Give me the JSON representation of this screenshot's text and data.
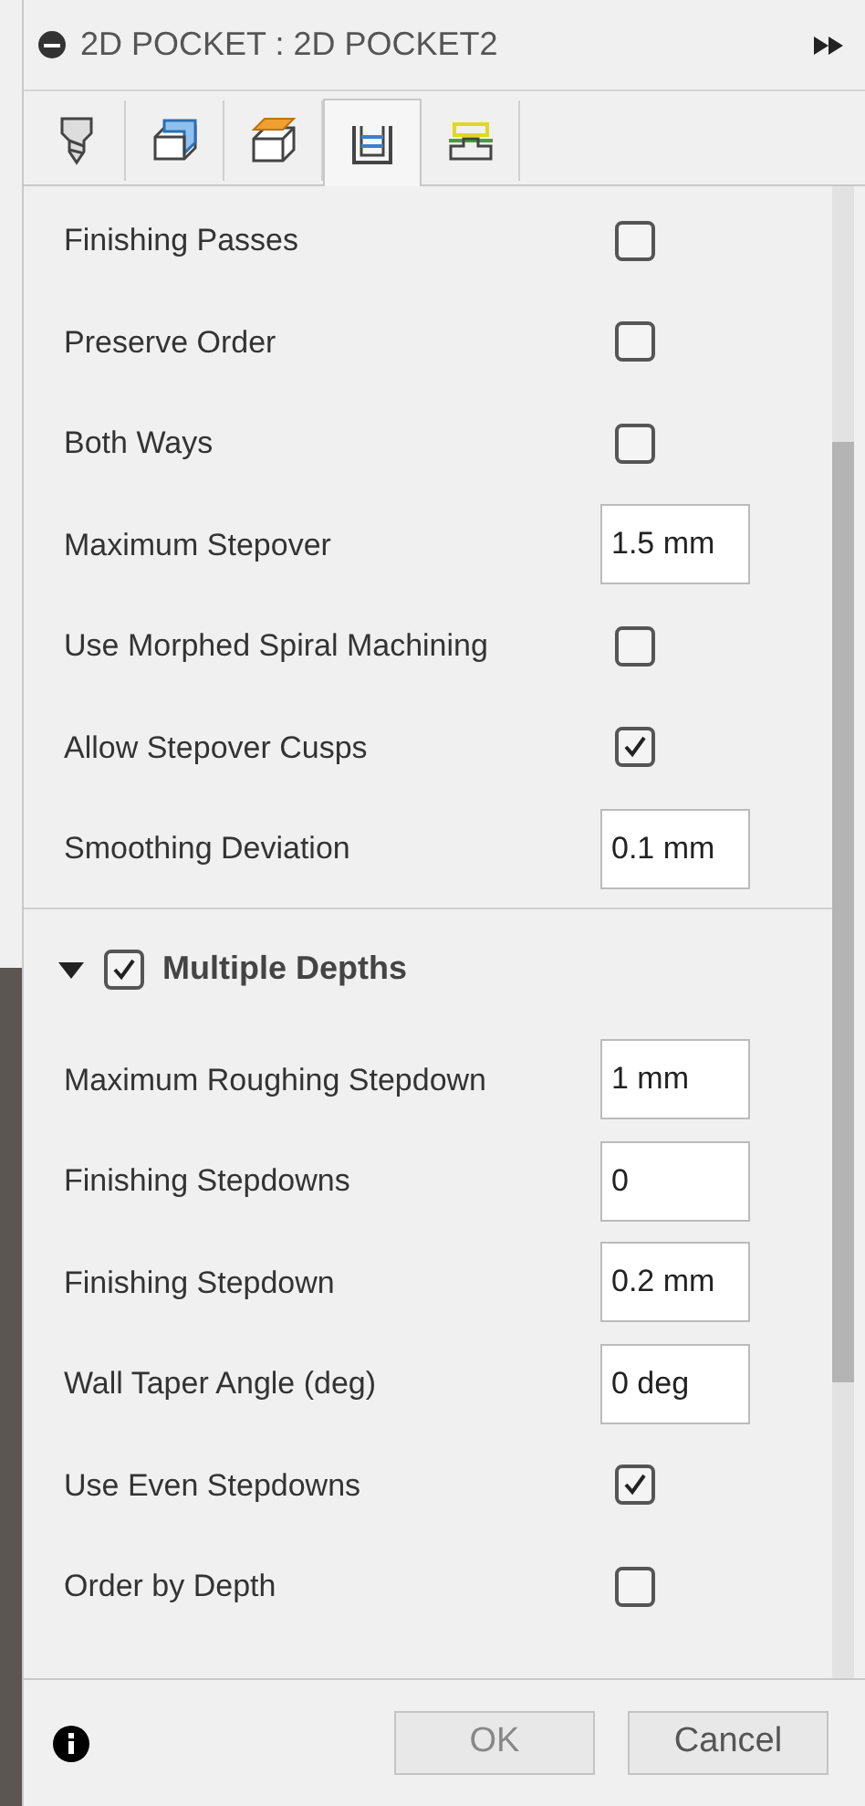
{
  "title": "2D POCKET : 2D POCKET2",
  "tabs": [
    {
      "kind": "tool",
      "selected": false
    },
    {
      "kind": "geometry",
      "selected": false
    },
    {
      "kind": "heights",
      "selected": false
    },
    {
      "kind": "passes",
      "selected": true
    },
    {
      "kind": "linking",
      "selected": false
    }
  ],
  "rows": [
    {
      "kind": "checkbox",
      "label": "Finishing Passes",
      "checked": false
    },
    {
      "kind": "checkbox",
      "label": "Preserve Order",
      "checked": false
    },
    {
      "kind": "checkbox",
      "label": "Both Ways",
      "checked": false
    },
    {
      "kind": "input",
      "label": "Maximum Stepover",
      "value": "1.5 mm"
    },
    {
      "kind": "checkbox",
      "label": "Use Morphed Spiral Machining",
      "checked": false
    },
    {
      "kind": "checkbox",
      "label": "Allow Stepover Cusps",
      "checked": true
    },
    {
      "kind": "input",
      "label": "Smoothing Deviation",
      "value": "0.1 mm"
    }
  ],
  "section": {
    "label": "Multiple Depths",
    "expanded": true,
    "checked": true,
    "rows": [
      {
        "kind": "input",
        "label": "Maximum Roughing Stepdown",
        "value": "1 mm"
      },
      {
        "kind": "input",
        "label": "Finishing Stepdowns",
        "value": "0"
      },
      {
        "kind": "input",
        "label": "Finishing Stepdown",
        "value": "0.2 mm"
      },
      {
        "kind": "input",
        "label": "Wall Taper Angle (deg)",
        "value": "0 deg"
      },
      {
        "kind": "checkbox",
        "label": "Use Even Stepdowns",
        "checked": true
      },
      {
        "kind": "checkbox",
        "label": "Order by Depth",
        "checked": false
      }
    ]
  },
  "buttons": [
    "OK",
    "Cancel"
  ]
}
